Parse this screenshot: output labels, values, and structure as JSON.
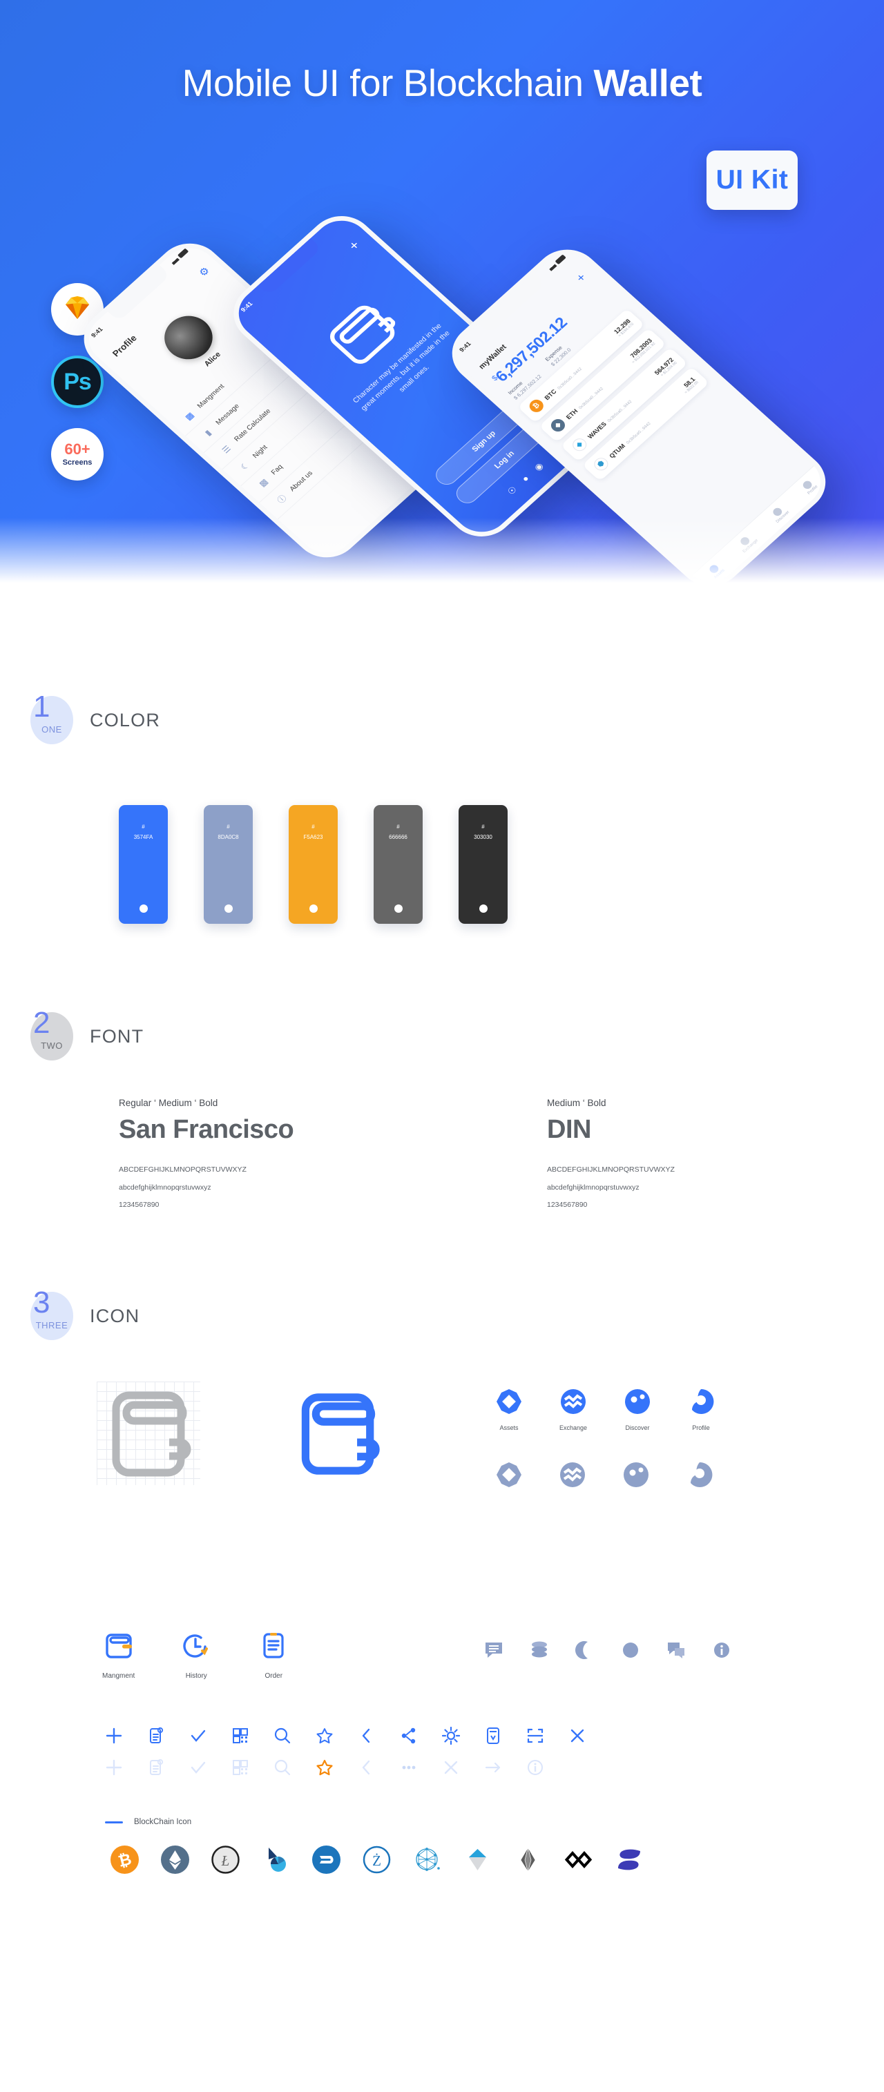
{
  "hero": {
    "title_regular": "Mobile UI for Blockchain ",
    "title_bold": "Wallet",
    "ui_kit_badge": "UI Kit",
    "badges": [
      {
        "name": "sketch",
        "label": "Sketch"
      },
      {
        "name": "photoshop",
        "label": "Ps"
      },
      {
        "name": "screens",
        "num": "60+",
        "lbl": "Screens"
      }
    ]
  },
  "phones": {
    "profile": {
      "status_time": "9:41",
      "title": "Profile",
      "gear_icon": "gear-icon",
      "name": "Alice",
      "menu": [
        {
          "label": "Mangment",
          "icon": "wallet-icon"
        },
        {
          "label": "Message",
          "icon": "message-icon"
        },
        {
          "label": "Rate Calculate",
          "icon": "coins-icon"
        },
        {
          "label": "Night",
          "icon": "moon-icon"
        },
        {
          "label": "Faq",
          "icon": "chat-icon"
        },
        {
          "label": "About us",
          "icon": "info-icon"
        }
      ]
    },
    "splash": {
      "status_time": "9:41",
      "plus_icon": "plus-icon",
      "wallet_icon": "wallet-icon",
      "quote": "Character may be manifested in the great moments, but it is made in the small ones.",
      "buttons": [
        "Sign up",
        "Log in"
      ],
      "socials": [
        "twitter-icon",
        "facebook-icon",
        "google-icon"
      ]
    },
    "assets": {
      "status_time": "9:41",
      "title": "myWallet",
      "plus_icon": "plus-icon",
      "currency_symbol": "$",
      "balance": "6,297,502.12",
      "stats": [
        {
          "label": "Income",
          "value": "$ 6,297,502.12"
        },
        {
          "label": "Expense",
          "value": "$ 22,300.0"
        }
      ],
      "assets": [
        {
          "symbol": "BTC",
          "address": "0x3b5ca0...9442",
          "amount": "12.298",
          "usd": "≈ $184,470",
          "color": "#F7931A"
        },
        {
          "symbol": "ETH",
          "address": "0x3b5ca0...9442",
          "amount": "708.2003",
          "usd": "≈ $12,092,021.92",
          "color": "#54708B"
        },
        {
          "symbol": "WAVES",
          "address": "0x3b5ca0...9442",
          "amount": "564.972",
          "usd": "≈ $1,204.00",
          "color": "#27A2DB"
        },
        {
          "symbol": "QTUM",
          "address": "0x3b5ca0...9442",
          "amount": "58.1",
          "usd": "≈ $922.00",
          "color": "#2E9AD0"
        }
      ],
      "tabs": [
        {
          "label": "Assets",
          "active": true
        },
        {
          "label": "Exchange",
          "active": false
        },
        {
          "label": "Discover",
          "active": false
        },
        {
          "label": "Profile",
          "active": false
        }
      ]
    }
  },
  "sections": [
    {
      "digit": "1",
      "word": "ONE",
      "title": "COLOR"
    },
    {
      "digit": "2",
      "word": "TWO",
      "title": "FONT"
    },
    {
      "digit": "3",
      "word": "THREE",
      "title": "ICON"
    }
  ],
  "color_section": {
    "swatches": [
      {
        "hex": "3574FA",
        "css": "#3574FA"
      },
      {
        "hex": "8DA0C8",
        "css": "#8DA0C8"
      },
      {
        "hex": "F5A623",
        "css": "#F5A623"
      },
      {
        "hex": "666666",
        "css": "#666666"
      },
      {
        "hex": "303030",
        "css": "#303030"
      }
    ],
    "hash_symbol": "#"
  },
  "font_section": {
    "columns": [
      {
        "weights": "Regular ‘ Medium ‘ Bold",
        "name": "San Francisco",
        "upper": "ABCDEFGHIJKLMNOPQRSTUVWXYZ",
        "lower": "abcdefghijklmnopqrstuvwxyz",
        "digits": "1234567890"
      },
      {
        "weights": "Medium ‘ Bold",
        "name": "DIN",
        "upper": "ABCDEFGHIJKLMNOPQRSTUVWXYZ",
        "lower": "abcdefghijklmnopqrstuvwxyz",
        "digits": "1234567890"
      }
    ]
  },
  "icon_section": {
    "wallet_outline_icon": "wallet-outline-icon",
    "wallet_blue_icon": "wallet-filled-icon",
    "tab_icons": [
      {
        "label": "Assets",
        "icon": "assets-icon"
      },
      {
        "label": "Exchange",
        "icon": "exchange-icon"
      },
      {
        "label": "Discover",
        "icon": "discover-icon"
      },
      {
        "label": "Profile",
        "icon": "profile-icon"
      }
    ],
    "feature_icons": [
      {
        "label": "Mangment",
        "icon": "wallet-management-icon"
      },
      {
        "label": "History",
        "icon": "history-clock-icon"
      },
      {
        "label": "Order",
        "icon": "order-clipboard-icon"
      }
    ],
    "grey_icons": [
      "message-lines-icon",
      "coins-stack-icon",
      "moon-icon",
      "circle-icon",
      "chat-bubbles-icon",
      "info-icon"
    ],
    "blue_icons": [
      "plus-icon",
      "note-settings-icon",
      "check-icon",
      "qr-code-icon",
      "search-icon",
      "star-icon",
      "chevron-left-icon",
      "share-icon",
      "gear-icon",
      "phone-wallet-icon",
      "scan-icon",
      "close-icon"
    ],
    "faded_icons": [
      "plus-icon",
      "note-icon",
      "check-icon",
      "qr-code-icon",
      "search-icon",
      "star-filled-icon",
      "chevron-left-icon",
      "ellipsis-icon",
      "close-icon",
      "arrow-right-icon",
      "info-circle-icon"
    ],
    "blockchain_label": "BlockChain Icon",
    "coins": [
      {
        "name": "Bitcoin",
        "symbol": "₿",
        "bg": "#F7931A",
        "fg": "#ffffff"
      },
      {
        "name": "Ethereum",
        "symbol": "♦",
        "bg": "#54708B",
        "fg": "#ffffff"
      },
      {
        "name": "Litecoin",
        "symbol": "Ł",
        "bg": "#ffffff",
        "fg": "#b4b4b4"
      },
      {
        "name": "BitShares",
        "symbol": "◤",
        "bg": "#ffffff",
        "fg": "#1B3D6E"
      },
      {
        "name": "Dash",
        "symbol": "D",
        "bg": "#1C75BC",
        "fg": "#ffffff"
      },
      {
        "name": "Zcash",
        "symbol": "Z",
        "bg": "#ffffff",
        "fg": "#1C75BC"
      },
      {
        "name": "QTUM",
        "symbol": "⬢",
        "bg": "#ffffff",
        "fg": "#2E9AD0"
      },
      {
        "name": "Waves",
        "symbol": "◆",
        "bg": "#ffffff",
        "fg": "#27A2DB"
      },
      {
        "name": "EOS",
        "symbol": "◇",
        "bg": "#ffffff",
        "fg": "#5C5C5C"
      },
      {
        "name": "BitConnect",
        "symbol": "⬧",
        "bg": "#ffffff",
        "fg": "#000000"
      },
      {
        "name": "Kyber",
        "symbol": "◐",
        "bg": "#ffffff",
        "fg": "#3D3BB5"
      }
    ]
  }
}
